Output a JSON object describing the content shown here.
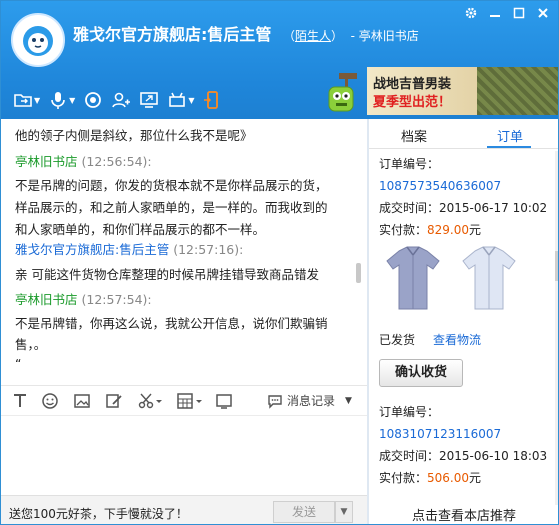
{
  "header": {
    "title": "雅戈尔官方旗舰店:售后主管",
    "stranger_open": "（",
    "stranger_label": "陌生人",
    "stranger_close": "）",
    "sub": "- 亭林旧书店"
  },
  "ad": {
    "line1": "战地吉普男装",
    "line2": "夏季型出范！"
  },
  "chat": {
    "m0": "他的领子内侧是斜纹，那位什么我不是呢》",
    "n1": "亭林旧书店",
    "t1": "(12:56:54):",
    "m1a": "不是吊牌的问题，你发的货根本就不是你样品展示的货，",
    "m1b": "样品展示的，和之前人家晒单的，是一样的。而我收到的",
    "m1c": "和人家晒单的，和你们样品展示的都不一样。",
    "n2": "雅戈尔官方旗舰店:售后主管",
    "t2": "(12:57:16):",
    "m2": "亲 可能这件货物仓库整理的时候吊牌挂错导致商品错发",
    "n3": "亭林旧书店",
    "t3": "(12:57:54):",
    "m3a": "不是吊牌错，你再这么说，我就公开信息，说你们欺骗销",
    "m3b": "售，。",
    "m3c": "“"
  },
  "input_toolbar": {
    "history_label": "消息记录"
  },
  "footer": {
    "tip": "送您100元好茶，下手慢就没了！",
    "send_label": "发送"
  },
  "right": {
    "tab_archive": "档案",
    "tab_order": "订单",
    "orders": [
      {
        "num_label": "订单编号：",
        "num": "1087573540636007",
        "date_label": "成交时间：",
        "date": "2015-06-17 10:02",
        "paid_label": "实付款：",
        "price": "829.00",
        "unit": "元"
      },
      {
        "num_label": "订单编号：",
        "num": "1083107123116007",
        "date_label": "成交时间：",
        "date": "2015-06-10 18:03",
        "paid_label": "实付款：",
        "price": "506.00",
        "unit": "元"
      }
    ],
    "shipped": "已发货",
    "logistics": "查看物流",
    "confirm": "确认收货",
    "bottom": "点击查看本店推荐"
  },
  "colors": {
    "accent": "#1f86da",
    "link": "#1a6ad6",
    "price": "#e85a00",
    "contact_name": "#1a9a2a"
  }
}
